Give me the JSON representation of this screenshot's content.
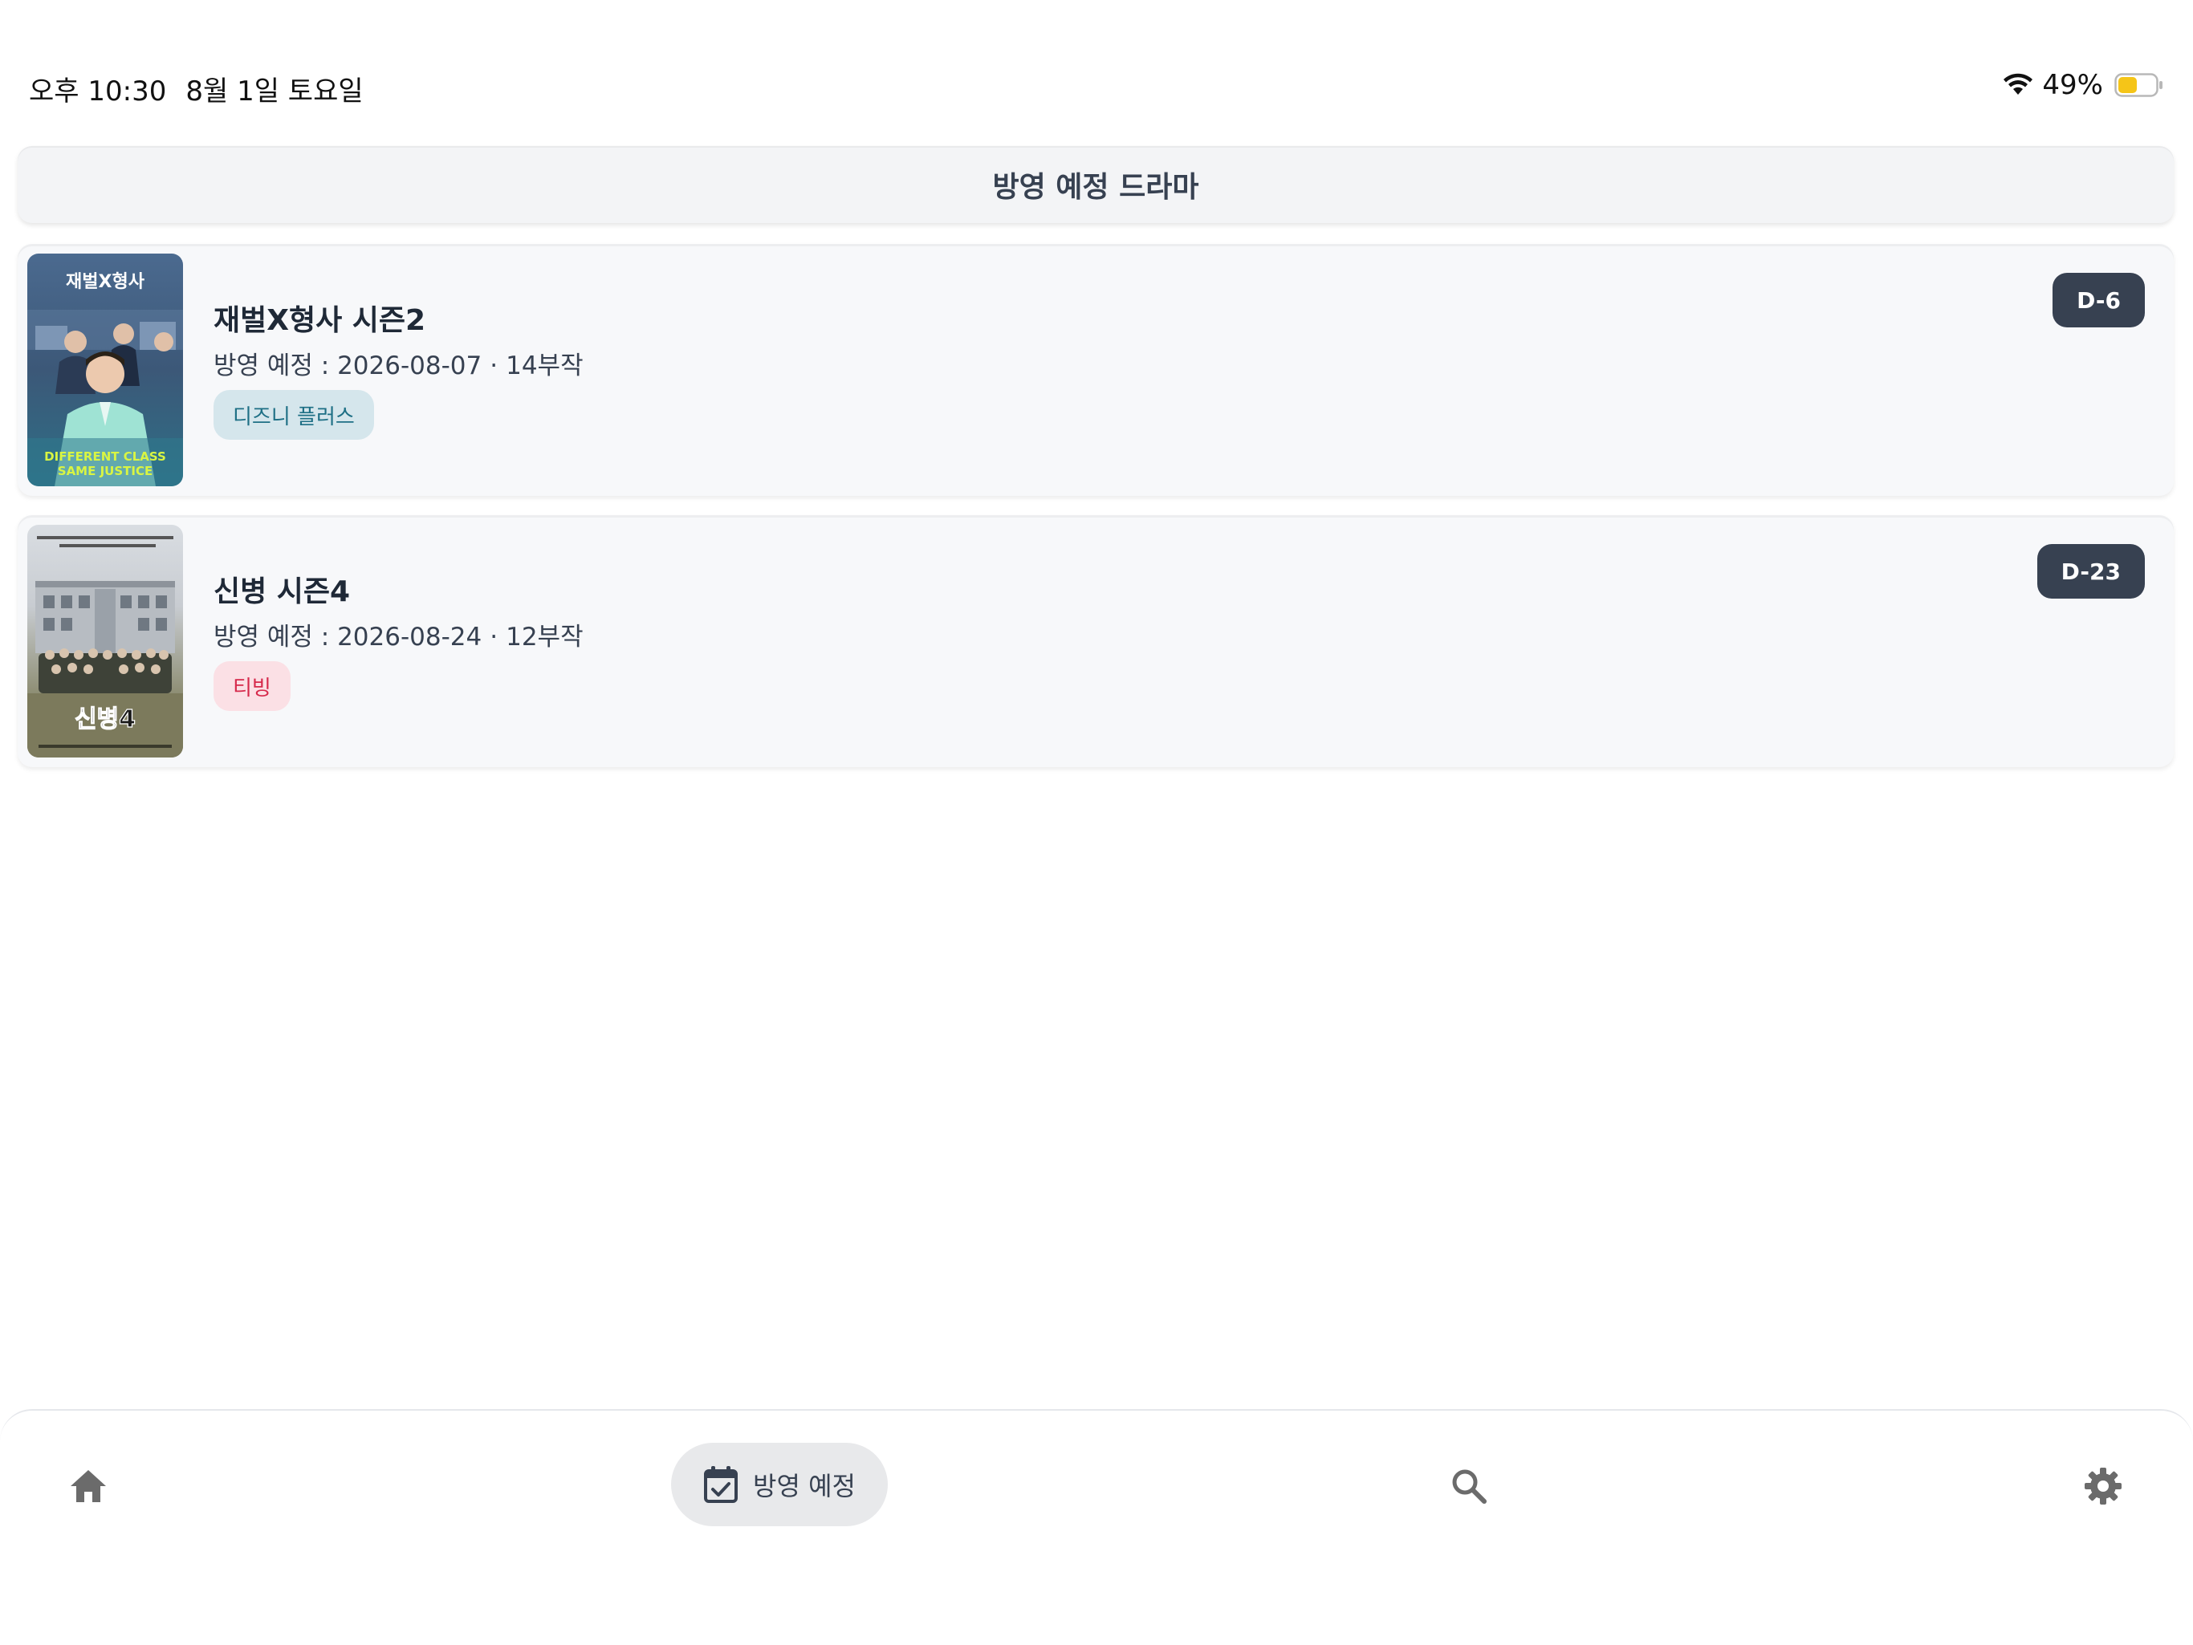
{
  "status_bar": {
    "time": "오후 10:30",
    "date": "8월 1일 토요일",
    "battery": "49%"
  },
  "header": {
    "title": "방영 예정 드라마"
  },
  "dramas": [
    {
      "title": "재벌X형사 시즌2",
      "info_prefix": "방영 예정 : 2026-08-07",
      "separator": "·",
      "episodes": "14부작",
      "platform": "디즈니 플러스",
      "dday": "D-6",
      "poster": {
        "top_text": "재벌X형사",
        "bottom_line1": "DIFFERENT CLASS",
        "bottom_line2": "SAME JUSTICE"
      }
    },
    {
      "title": "신병 시즌4",
      "info_prefix": "방영 예정 : 2026-08-24",
      "separator": "·",
      "episodes": "12부작",
      "platform": "티빙",
      "dday": "D-23",
      "poster": {
        "title_text": "신병4"
      }
    }
  ],
  "bottom_nav": {
    "home": "home-icon",
    "upcoming_label": "방영 예정",
    "search": "search-icon",
    "settings": "gear-icon"
  },
  "colors": {
    "accent": "#374151",
    "card_bg": "#f7f8fa",
    "disney_chip_bg": "#d5e6ec",
    "disney_chip_text": "#1d6f85",
    "tving_chip_bg": "#fbe0e5",
    "tving_chip_text": "#d6294b",
    "battery_fill": "#f5c518"
  }
}
